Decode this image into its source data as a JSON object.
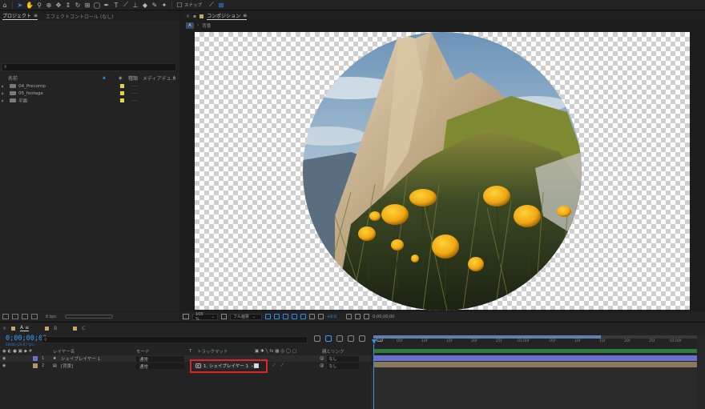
{
  "project": {
    "tabs": [
      "プロジェクト",
      "エフェクトコントロール (なし)"
    ],
    "columns": {
      "name": "名前",
      "type": "種類",
      "media": "メディアデュ..."
    },
    "items": [
      {
        "name": "04_Precomp",
        "type": "---"
      },
      {
        "name": "05_footage",
        "type": "---"
      },
      {
        "name": "平面",
        "type": "---"
      }
    ],
    "bpc": "8 bpc"
  },
  "composition": {
    "tab_label": "コンポジション",
    "crumb": "背景",
    "viewer": {
      "zoom": "100 %",
      "resolution": "フル画質",
      "exposure": "+0.0",
      "timecode": "0;00;00;00"
    }
  },
  "timeline": {
    "tabs": [
      "A",
      "B",
      "C"
    ],
    "timecode": "0;00;00;00",
    "fps": "00000 (29.97 fps)",
    "columns": {
      "layer_name": "レイヤー名",
      "mode": "モード",
      "t": "T",
      "track_matte": "トラックマット",
      "parent": "親とリンク"
    },
    "layers": [
      {
        "num": "1",
        "name": "シェイプレイヤー 1",
        "mode": "通常",
        "parent": "なし",
        "color": "#6a6fcf"
      },
      {
        "num": "2",
        "name": "[背景]",
        "mode": "通常",
        "parent": "なし",
        "color": "#b0946a"
      }
    ],
    "track_matte_value": "1. シェイプレイヤー 1",
    "ruler_ticks": [
      "0f",
      "05f",
      "10f",
      "15f",
      "20f",
      "25f",
      "01:00f",
      "05f",
      "10f",
      "15f",
      "20f",
      "25f",
      "02:00f"
    ]
  },
  "toolbar": {
    "snap_label": "スナップ"
  }
}
